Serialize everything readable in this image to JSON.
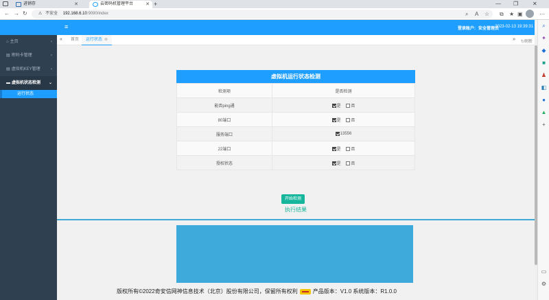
{
  "browser": {
    "tabs": [
      {
        "label": "进销存"
      },
      {
        "label": "云密码机管理平台"
      }
    ],
    "security_label": "不安全",
    "url_host": "192.168.6.10",
    "url_path": ":9090/index"
  },
  "header": {
    "login_label": "登录账户:",
    "user_name": "安全管理员",
    "datetime": "2023-02-13 19:39:31"
  },
  "sidebar": {
    "items": [
      {
        "label": "主页"
      },
      {
        "label": "密码卡管理"
      },
      {
        "label": "虚拟机KEY管理"
      },
      {
        "label": "虚拟机状态检测"
      }
    ],
    "subitem": "运行状态"
  },
  "content_tabs": {
    "home": "首页",
    "active": "运行状态",
    "refresh": "刷新"
  },
  "panel": {
    "title": "虚拟机运行状态检测",
    "headers": [
      "检测项",
      "是否检测"
    ],
    "rows": [
      {
        "item": "能否ping通",
        "yes": "是",
        "no": "否"
      },
      {
        "item": "80端口",
        "yes": "是",
        "no": "否"
      },
      {
        "item": "服务端口",
        "port": "13556"
      },
      {
        "item": "22端口",
        "yes": "是",
        "no": "否"
      },
      {
        "item": "授权状态",
        "yes": "是",
        "no": "否"
      }
    ]
  },
  "start_button": "开始检测",
  "result_title": "执行结果",
  "footer": {
    "text": "版权所有©2022奇安信网神信息技术（北京）股份有限公司，保留所有权利",
    "version": "产品版本：V1.0 系统版本：R1.0.0"
  },
  "colors": {
    "primary": "#1e9fff",
    "sidebar": "#2f4050",
    "success": "#16b69c",
    "result_box": "#3eaadc"
  }
}
